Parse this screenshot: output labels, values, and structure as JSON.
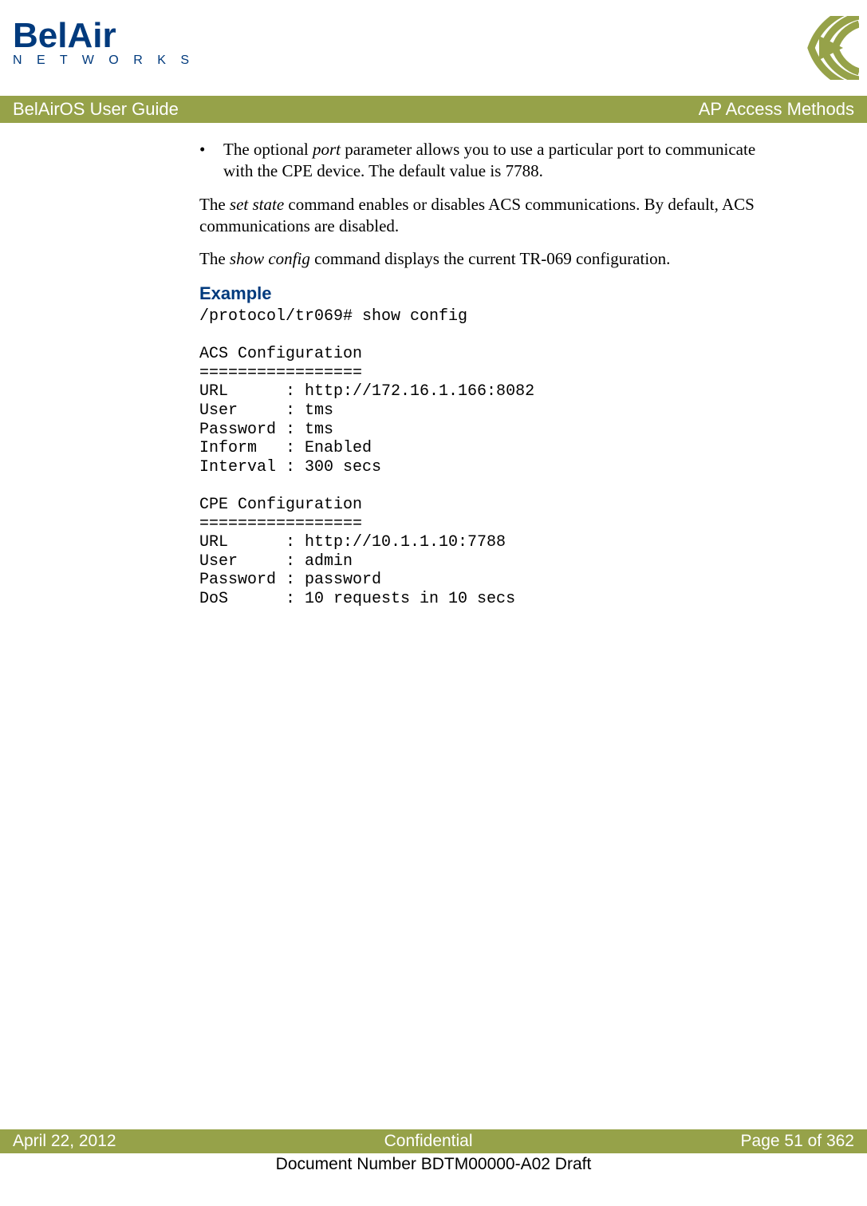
{
  "logo": {
    "line1": "BelAir",
    "line2": "N E T W O R K S"
  },
  "titleBar": {
    "left": "BelAirOS User Guide",
    "right": "AP Access Methods"
  },
  "content": {
    "bullet1_pre": "The optional ",
    "bullet1_em": "port",
    "bullet1_post": " parameter allows you to use a particular port to communicate with the CPE device. The default value is 7788.",
    "para1_pre": "The ",
    "para1_em": "set state",
    "para1_post": " command enables or disables ACS communications. By default, ACS communications are disabled.",
    "para2_pre": "The ",
    "para2_em": "show config",
    "para2_post": " command displays the current TR-069 configuration.",
    "exampleHeading": "Example",
    "code": "/protocol/tr069# show config\n\nACS Configuration\n=================\nURL      : http://172.16.1.166:8082\nUser     : tms\nPassword : tms\nInform   : Enabled\nInterval : 300 secs\n\nCPE Configuration\n=================\nURL      : http://10.1.1.10:7788\nUser     : admin\nPassword : password\nDoS      : 10 requests in 10 secs"
  },
  "footer": {
    "date": "April 22, 2012",
    "center": "Confidential",
    "page": "Page 51 of 362",
    "docnum": "Document Number BDTM00000-A02 Draft"
  }
}
